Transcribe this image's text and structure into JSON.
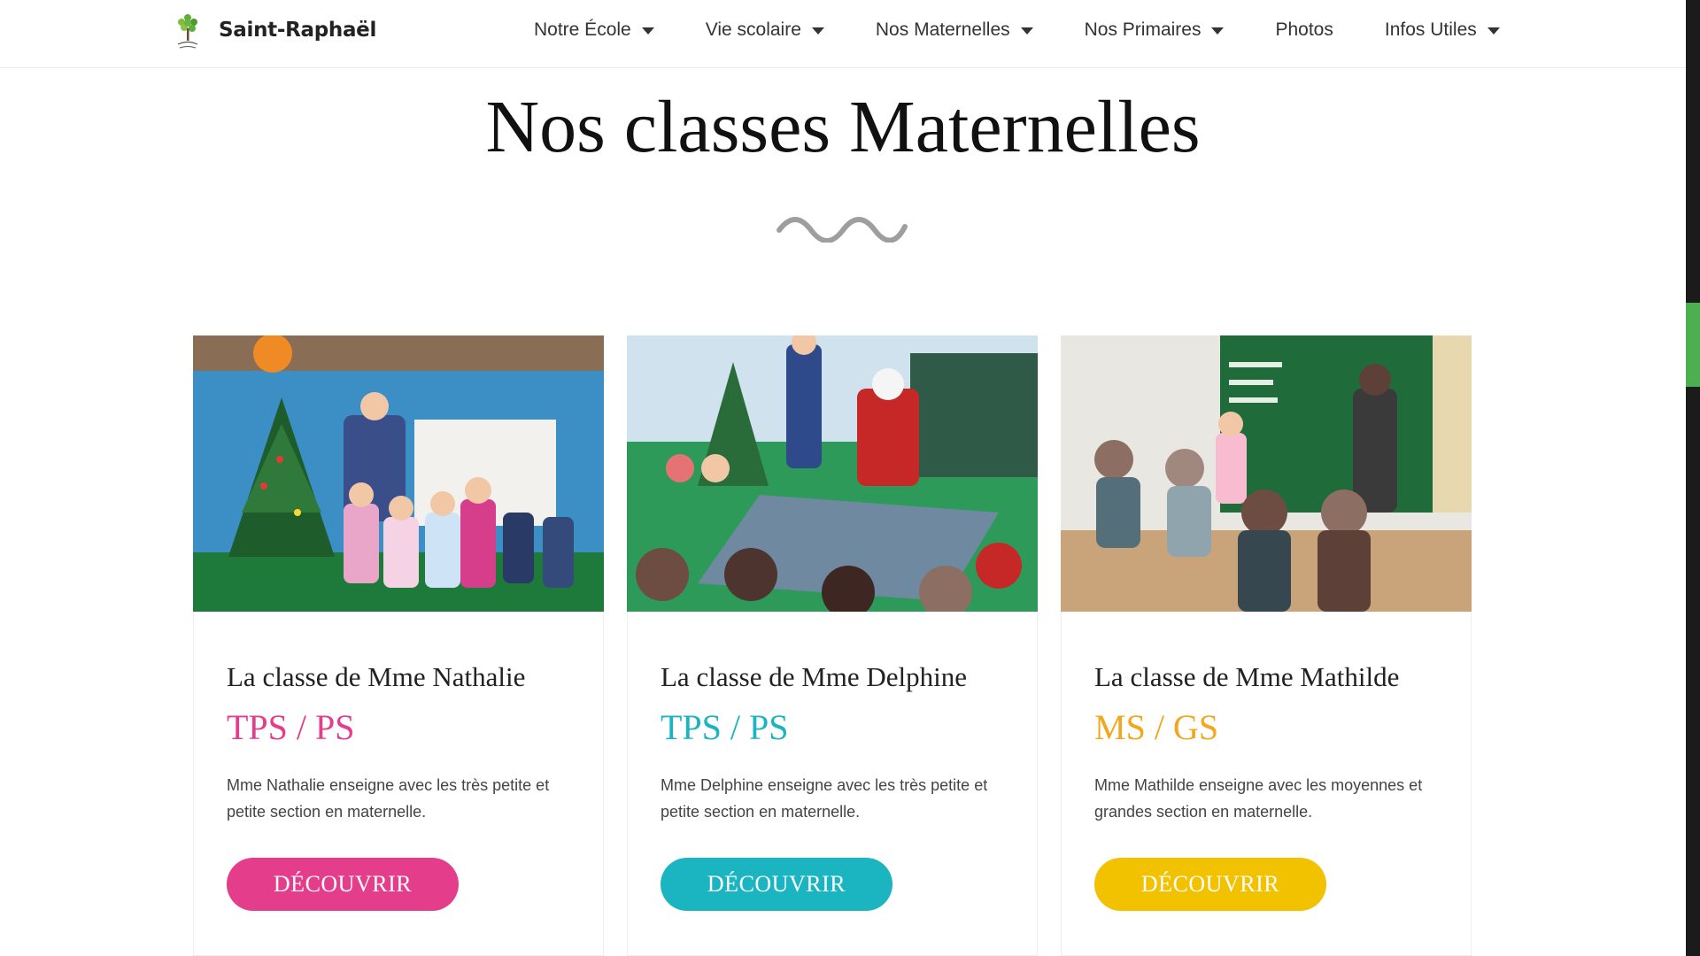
{
  "header": {
    "brand": "Saint-Raphaël",
    "nav": [
      {
        "label": "Notre École",
        "dropdown": true
      },
      {
        "label": "Vie scolaire",
        "dropdown": true
      },
      {
        "label": "Nos Maternelles",
        "dropdown": true
      },
      {
        "label": "Nos Primaires",
        "dropdown": true
      },
      {
        "label": "Photos",
        "dropdown": false
      },
      {
        "label": "Infos Utiles",
        "dropdown": true
      }
    ]
  },
  "main": {
    "heading": "Nos classes Maternelles",
    "cards": [
      {
        "title": "La classe de Mme Nathalie",
        "level": "TPS / PS",
        "description": "Mme Nathalie enseigne avec les très petite et petite section en maternelle.",
        "button": "DÉCOUVRIR",
        "accent": "#e33d8b"
      },
      {
        "title": "La classe de Mme Delphine",
        "level": "TPS / PS",
        "description": "Mme Delphine enseigne avec les très petite et petite section en maternelle.",
        "button": "DÉCOUVRIR",
        "accent": "#1bb5c2"
      },
      {
        "title": "La classe de Mme Mathilde",
        "level": "MS / GS",
        "description": "Mme Mathilde enseigne avec les moyennes et grandes section en maternelle.",
        "button": "DÉCOUVRIR",
        "accent": "#f2c100"
      }
    ]
  },
  "colors": {
    "scrollbar_thumb": "#4caf50",
    "squiggle": "#9e9e9e"
  }
}
